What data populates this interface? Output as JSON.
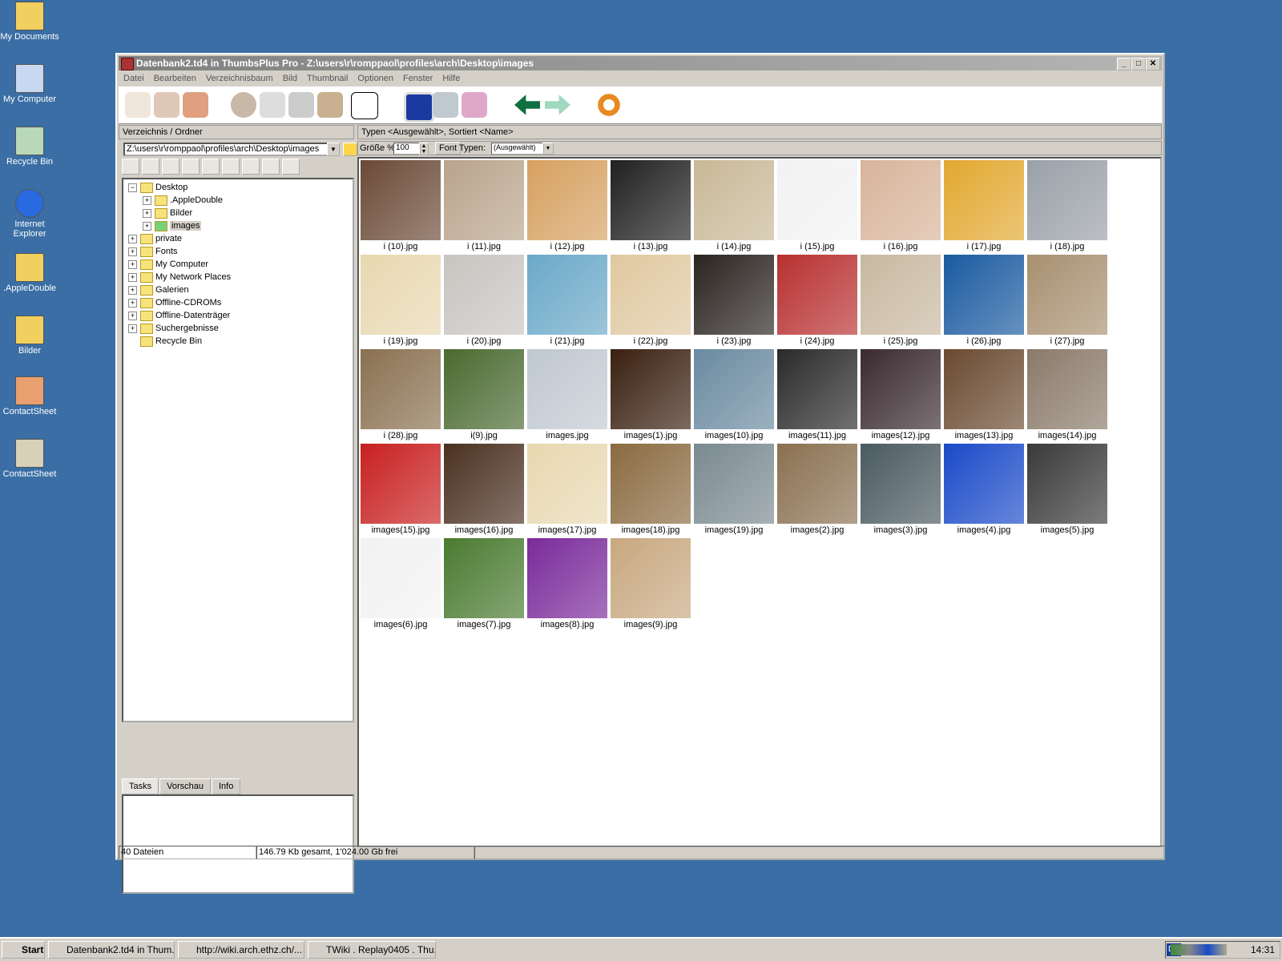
{
  "desktop": {
    "icons": [
      {
        "label": "My Documents",
        "icon": "folder-docs-icon"
      },
      {
        "label": "My Computer",
        "icon": "computer-icon"
      },
      {
        "label": "Recycle Bin",
        "icon": "recycle-bin-icon"
      },
      {
        "label": "Internet Explorer",
        "icon": "internet-explorer-icon"
      },
      {
        "label": ".AppleDouble",
        "icon": "folder-icon"
      },
      {
        "label": "Bilder",
        "icon": "folder-icon"
      },
      {
        "label": "ContactSheet",
        "icon": "contactsheet-icon"
      },
      {
        "label": "ContactSheet",
        "icon": "contactsheet-psd-icon"
      }
    ]
  },
  "window": {
    "title": "Datenbank2.td4 in ThumbsPlus Pro - Z:\\users\\r\\romppaol\\profiles\\arch\\Desktop\\images",
    "controls": {
      "minimize": "_",
      "maximize": "□",
      "close": "✕"
    }
  },
  "menu": [
    "Datei",
    "Bearbeiten",
    "Verzeichnisbaum",
    "Bild",
    "Thumbnail",
    "Optionen",
    "Fenster",
    "Hilfe"
  ],
  "left_pane": {
    "header": "Verzeichnis / Ordner",
    "path_value": "Z:\\users\\r\\romppaol\\profiles\\arch\\Desktop\\images",
    "tree": [
      {
        "label": "Desktop",
        "depth": 0,
        "exp": "−"
      },
      {
        "label": ".AppleDouble",
        "depth": 1,
        "exp": "+"
      },
      {
        "label": "Bilder",
        "depth": 1,
        "exp": "+"
      },
      {
        "label": "images",
        "depth": 1,
        "exp": "+",
        "selected": true
      },
      {
        "label": "private",
        "depth": 0,
        "exp": "+"
      },
      {
        "label": "Fonts",
        "depth": 0,
        "exp": "+"
      },
      {
        "label": "My Computer",
        "depth": 0,
        "exp": "+"
      },
      {
        "label": "My Network Places",
        "depth": 0,
        "exp": "+"
      },
      {
        "label": "Galerien",
        "depth": 0,
        "exp": "+"
      },
      {
        "label": "Offline-CDROMs",
        "depth": 0,
        "exp": "+"
      },
      {
        "label": "Offline-Datenträger",
        "depth": 0,
        "exp": "+"
      },
      {
        "label": "Suchergebnisse",
        "depth": 0,
        "exp": "+"
      },
      {
        "label": "Recycle Bin",
        "depth": 0,
        "exp": ""
      }
    ],
    "tabs": [
      "Tasks",
      "Vorschau",
      "Info"
    ]
  },
  "right_pane": {
    "header": "Typen <Ausgewählt>, Sortiert <Name>",
    "size_label": "Größe %",
    "size_value": "100",
    "font_button": "Font",
    "types_label": "Typen:",
    "types_value": "(Ausgewählt)",
    "thumbs": [
      {
        "name": "i (10).jpg",
        "color": "#6b4a36"
      },
      {
        "name": "i (11).jpg",
        "color": "#b9a48c"
      },
      {
        "name": "i (12).jpg",
        "color": "#d6a060"
      },
      {
        "name": "i (13).jpg",
        "color": "#202020"
      },
      {
        "name": "i (14).jpg",
        "color": "#c8b896"
      },
      {
        "name": "i (15).jpg",
        "color": "#f2f2f2"
      },
      {
        "name": "i (16).jpg",
        "color": "#d8b49a"
      },
      {
        "name": "i (17).jpg",
        "color": "#e2a830"
      },
      {
        "name": "i (18).jpg",
        "color": "#9aa0a8"
      },
      {
        "name": "i (19).jpg",
        "color": "#e8d8b0"
      },
      {
        "name": "i (20).jpg",
        "color": "#c8c4c0"
      },
      {
        "name": "i (21).jpg",
        "color": "#6aa8c8"
      },
      {
        "name": "i (22).jpg",
        "color": "#e0c8a0"
      },
      {
        "name": "i (23).jpg",
        "color": "#2a2420"
      },
      {
        "name": "i (24).jpg",
        "color": "#b83030"
      },
      {
        "name": "i (25).jpg",
        "color": "#c8b8a0"
      },
      {
        "name": "i (26).jpg",
        "color": "#1a5aa0"
      },
      {
        "name": "i (27).jpg",
        "color": "#a89070"
      },
      {
        "name": "i (28).jpg",
        "color": "#8a7050"
      },
      {
        "name": "i(9).jpg",
        "color": "#4a6a30"
      },
      {
        "name": "images.jpg",
        "color": "#c0c8d0"
      },
      {
        "name": "images(1).jpg",
        "color": "#3a2010"
      },
      {
        "name": "images(10).jpg",
        "color": "#6a8aa0"
      },
      {
        "name": "images(11).jpg",
        "color": "#2a2a2a"
      },
      {
        "name": "images(12).jpg",
        "color": "#3a2a30"
      },
      {
        "name": "images(13).jpg",
        "color": "#6a4a30"
      },
      {
        "name": "images(14).jpg",
        "color": "#8a7a6a"
      },
      {
        "name": "images(15).jpg",
        "color": "#c82020"
      },
      {
        "name": "images(16).jpg",
        "color": "#4a3020"
      },
      {
        "name": "images(17).jpg",
        "color": "#e8d8b0"
      },
      {
        "name": "images(18).jpg",
        "color": "#8a6a40"
      },
      {
        "name": "images(19).jpg",
        "color": "#7a8a90"
      },
      {
        "name": "images(2).jpg",
        "color": "#8a7050"
      },
      {
        "name": "images(3).jpg",
        "color": "#4a5a60"
      },
      {
        "name": "images(4).jpg",
        "color": "#1a4ac8"
      },
      {
        "name": "images(5).jpg",
        "color": "#3a3a3a"
      },
      {
        "name": "images(6).jpg",
        "color": "#f2f2f2"
      },
      {
        "name": "images(7).jpg",
        "color": "#4a7a30"
      },
      {
        "name": "images(8).jpg",
        "color": "#7a2a9a"
      },
      {
        "name": "images(9).jpg",
        "color": "#c8a880"
      }
    ]
  },
  "status": {
    "files": "40 Dateien",
    "size": "146.79 Kb gesamt, 1'024.00 Gb frei"
  },
  "taskbar": {
    "start": "Start",
    "tasks": [
      "Datenbank2.td4 in Thum...",
      "http://wiki.arch.ethz.ch/...",
      "TWiki . Replay0405 . Thu..."
    ],
    "lang": "DE",
    "clock": "14:31"
  },
  "colors": {
    "desktop_bg": "#3a6ea5",
    "title_inactive": "#808080",
    "selection": "#d4d0c8"
  }
}
